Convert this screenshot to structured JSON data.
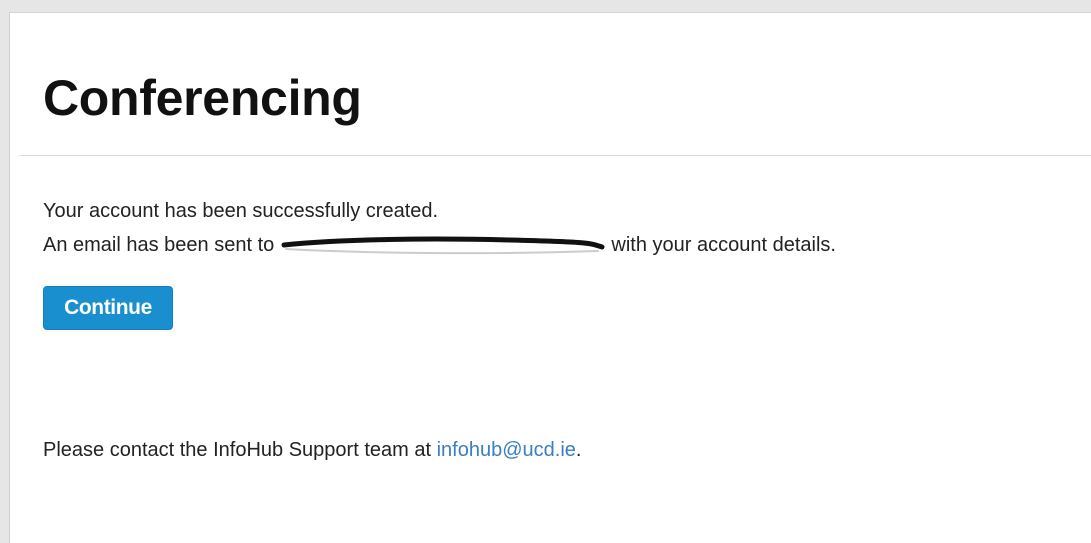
{
  "page": {
    "title": "Conferencing"
  },
  "message": {
    "line1": "Your account has been successfully created.",
    "line2_prefix": "An email has been sent to",
    "line2_suffix": "with your account details."
  },
  "actions": {
    "continue_label": "Continue"
  },
  "footer": {
    "support_prefix": "Please contact the InfoHub Support team at",
    "support_email": "infohub@ucd.ie",
    "support_suffix": "."
  },
  "colors": {
    "button_bg": "#1a8fcf",
    "link": "#3a7fc1",
    "text": "#222222"
  },
  "icons": {
    "redaction": "redaction-scribble-icon"
  }
}
